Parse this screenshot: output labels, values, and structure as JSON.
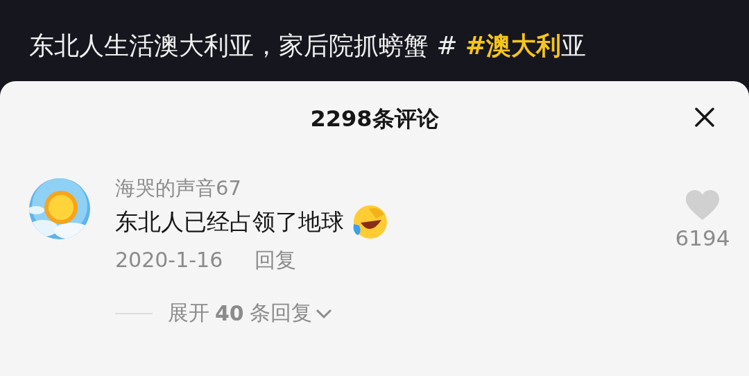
{
  "caption": [
    {
      "kind": "text",
      "text": "东北人生活澳大利亚，家后院抓螃蟹 # "
    },
    {
      "kind": "hashtag",
      "text": "#澳大利"
    },
    {
      "kind": "text",
      "text": "亚"
    }
  ],
  "sheet": {
    "title": "2298条评论"
  },
  "comments": [
    {
      "user": "海哭的声音67",
      "text": "东北人已经占领了地球",
      "date": "2020-1-16",
      "reply": "回复",
      "likes": "6194",
      "liked": false,
      "expand": "展开",
      "expand_count": "40",
      "expand_rest": "条回复"
    }
  ]
}
